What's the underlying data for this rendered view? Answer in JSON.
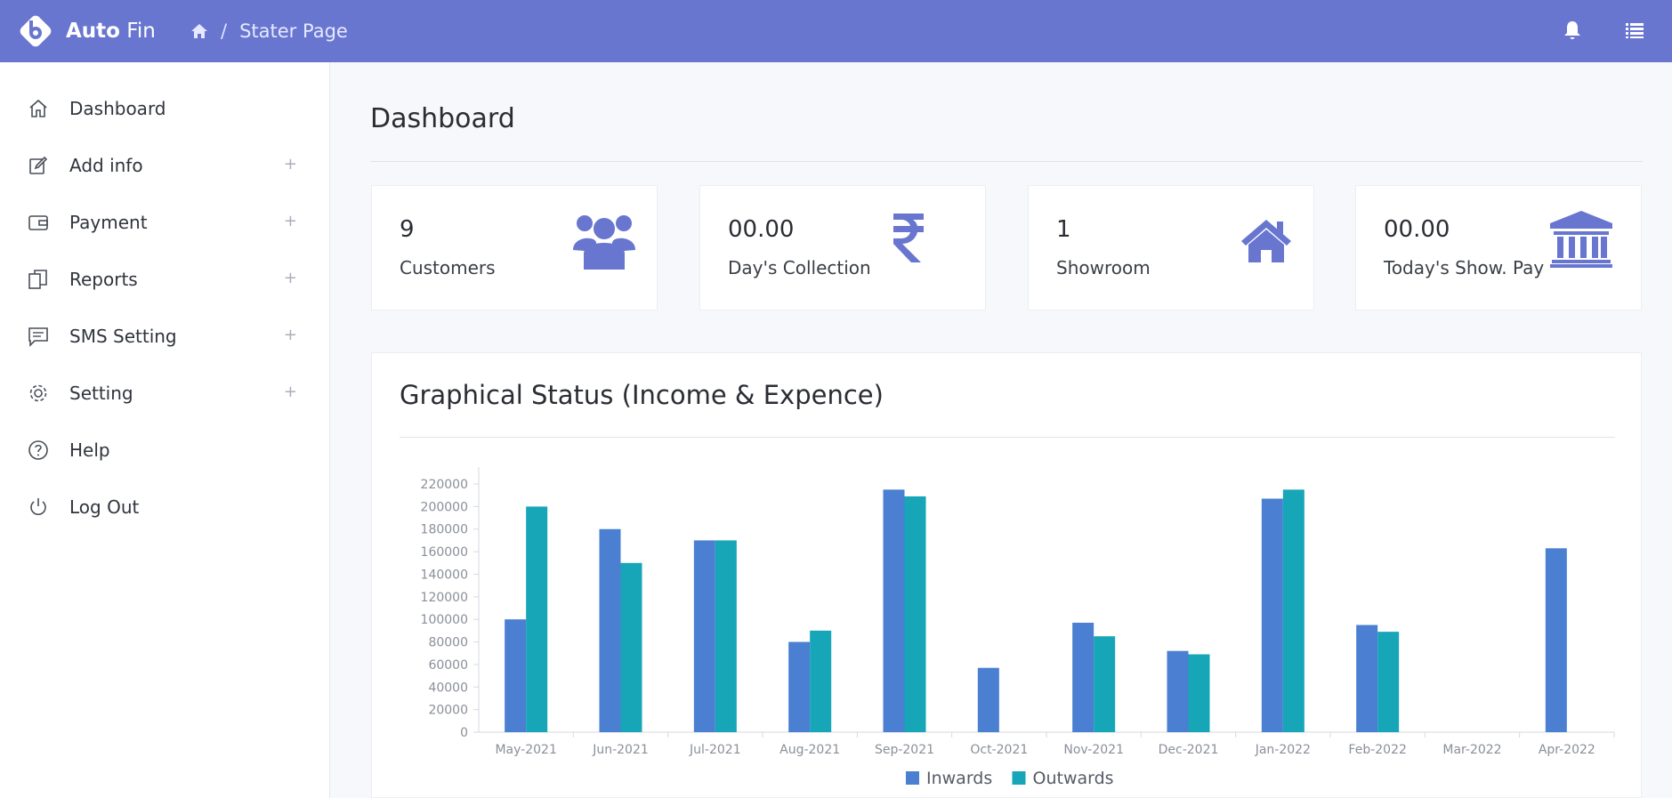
{
  "app": {
    "brand_bold": "Auto",
    "brand_rest": "Fin"
  },
  "breadcrumb": {
    "separator": "/",
    "current": "Stater Page"
  },
  "sidebar": {
    "items": [
      {
        "label": "Dashboard",
        "icon": "home-icon",
        "expandable": false
      },
      {
        "label": "Add info",
        "icon": "edit-icon",
        "expandable": true
      },
      {
        "label": "Payment",
        "icon": "wallet-icon",
        "expandable": true
      },
      {
        "label": "Reports",
        "icon": "documents-icon",
        "expandable": true
      },
      {
        "label": "SMS Setting",
        "icon": "message-icon",
        "expandable": true
      },
      {
        "label": "Setting",
        "icon": "gear-icon",
        "expandable": true
      },
      {
        "label": "Help",
        "icon": "help-icon",
        "expandable": false
      },
      {
        "label": "Log Out",
        "icon": "power-icon",
        "expandable": false
      }
    ],
    "expand_symbol": "+"
  },
  "main": {
    "title": "Dashboard",
    "cards": [
      {
        "value": "9",
        "label": "Customers",
        "icon": "users-icon"
      },
      {
        "value": "00.00",
        "label": "Day's Collection",
        "icon": "rupee-icon"
      },
      {
        "value": "1",
        "label": "Showroom",
        "icon": "house-icon"
      },
      {
        "value": "00.00",
        "label": "Today's Show. Pay",
        "icon": "bank-icon"
      }
    ],
    "chart_title": "Graphical Status (Income & Expence)"
  },
  "colors": {
    "topbar": "#6876d0",
    "accent": "#6876d0",
    "inwards": "#4a7fd1",
    "outwards": "#17a5b8"
  },
  "chart_data": {
    "type": "bar",
    "categories": [
      "May-2021",
      "Jun-2021",
      "Jul-2021",
      "Aug-2021",
      "Sep-2021",
      "Oct-2021",
      "Nov-2021",
      "Dec-2021",
      "Jan-2022",
      "Feb-2022",
      "Mar-2022",
      "Apr-2022"
    ],
    "series": [
      {
        "name": "Inwards",
        "values": [
          100000,
          180000,
          170000,
          80000,
          215000,
          57000,
          97000,
          72000,
          207000,
          95000,
          0,
          163000
        ]
      },
      {
        "name": "Outwards",
        "values": [
          200000,
          150000,
          170000,
          90000,
          209000,
          0,
          85000,
          69000,
          215000,
          89000,
          0,
          0
        ]
      }
    ],
    "yticks": [
      0,
      20000,
      40000,
      60000,
      80000,
      100000,
      120000,
      140000,
      160000,
      180000,
      200000,
      220000
    ],
    "ylim": [
      0,
      235000
    ],
    "legend": "bottom-center",
    "grid": false
  }
}
